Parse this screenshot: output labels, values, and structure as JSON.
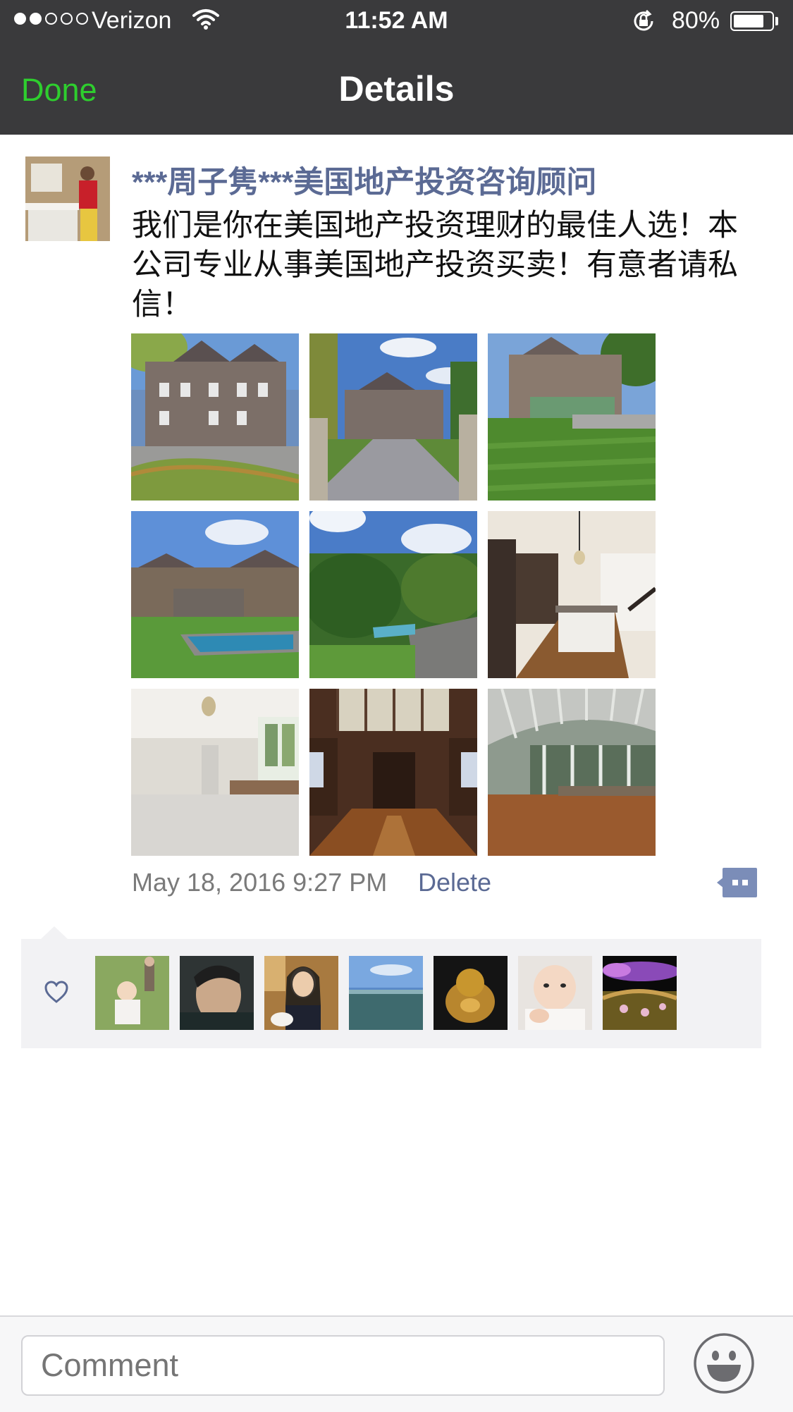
{
  "status_bar": {
    "carrier": "Verizon",
    "time": "11:52 AM",
    "battery_percent": "80%",
    "battery_level": 0.8,
    "signal_bars_filled": 2,
    "signal_bars_total": 5
  },
  "nav": {
    "done_label": "Done",
    "title": "Details"
  },
  "post": {
    "author": "***周子隽***美国地产投资咨询顾问",
    "text": "我们是你在美国地产投资理财的最佳人选！本公司专业从事美国地产投资买卖！有意者请私信！",
    "timestamp": "May 18, 2016 9:27 PM",
    "delete_label": "Delete",
    "photos": [
      {
        "subject": "mansion exterior with driveway"
      },
      {
        "subject": "gated driveway to mansion"
      },
      {
        "subject": "mansion and lawn"
      },
      {
        "subject": "house with pool"
      },
      {
        "subject": "aerial view of pool and trees"
      },
      {
        "subject": "kitchen interior"
      },
      {
        "subject": "white marble bathroom"
      },
      {
        "subject": "wood paneled hall"
      },
      {
        "subject": "sunroom with wood floor"
      }
    ]
  },
  "likes": {
    "likers": [
      {
        "subject": "toddler on grass"
      },
      {
        "subject": "man portrait"
      },
      {
        "subject": "woman in cafe"
      },
      {
        "subject": "landscape sky"
      },
      {
        "subject": "golden buddha figure"
      },
      {
        "subject": "baby photo"
      },
      {
        "subject": "purple flower field"
      }
    ]
  },
  "comment": {
    "placeholder": "Comment"
  },
  "colors": {
    "nav_bg": "#3a3a3c",
    "done_green": "#2ece2e",
    "link_blue": "#5b6a94",
    "likes_bg": "#f2f2f4"
  }
}
